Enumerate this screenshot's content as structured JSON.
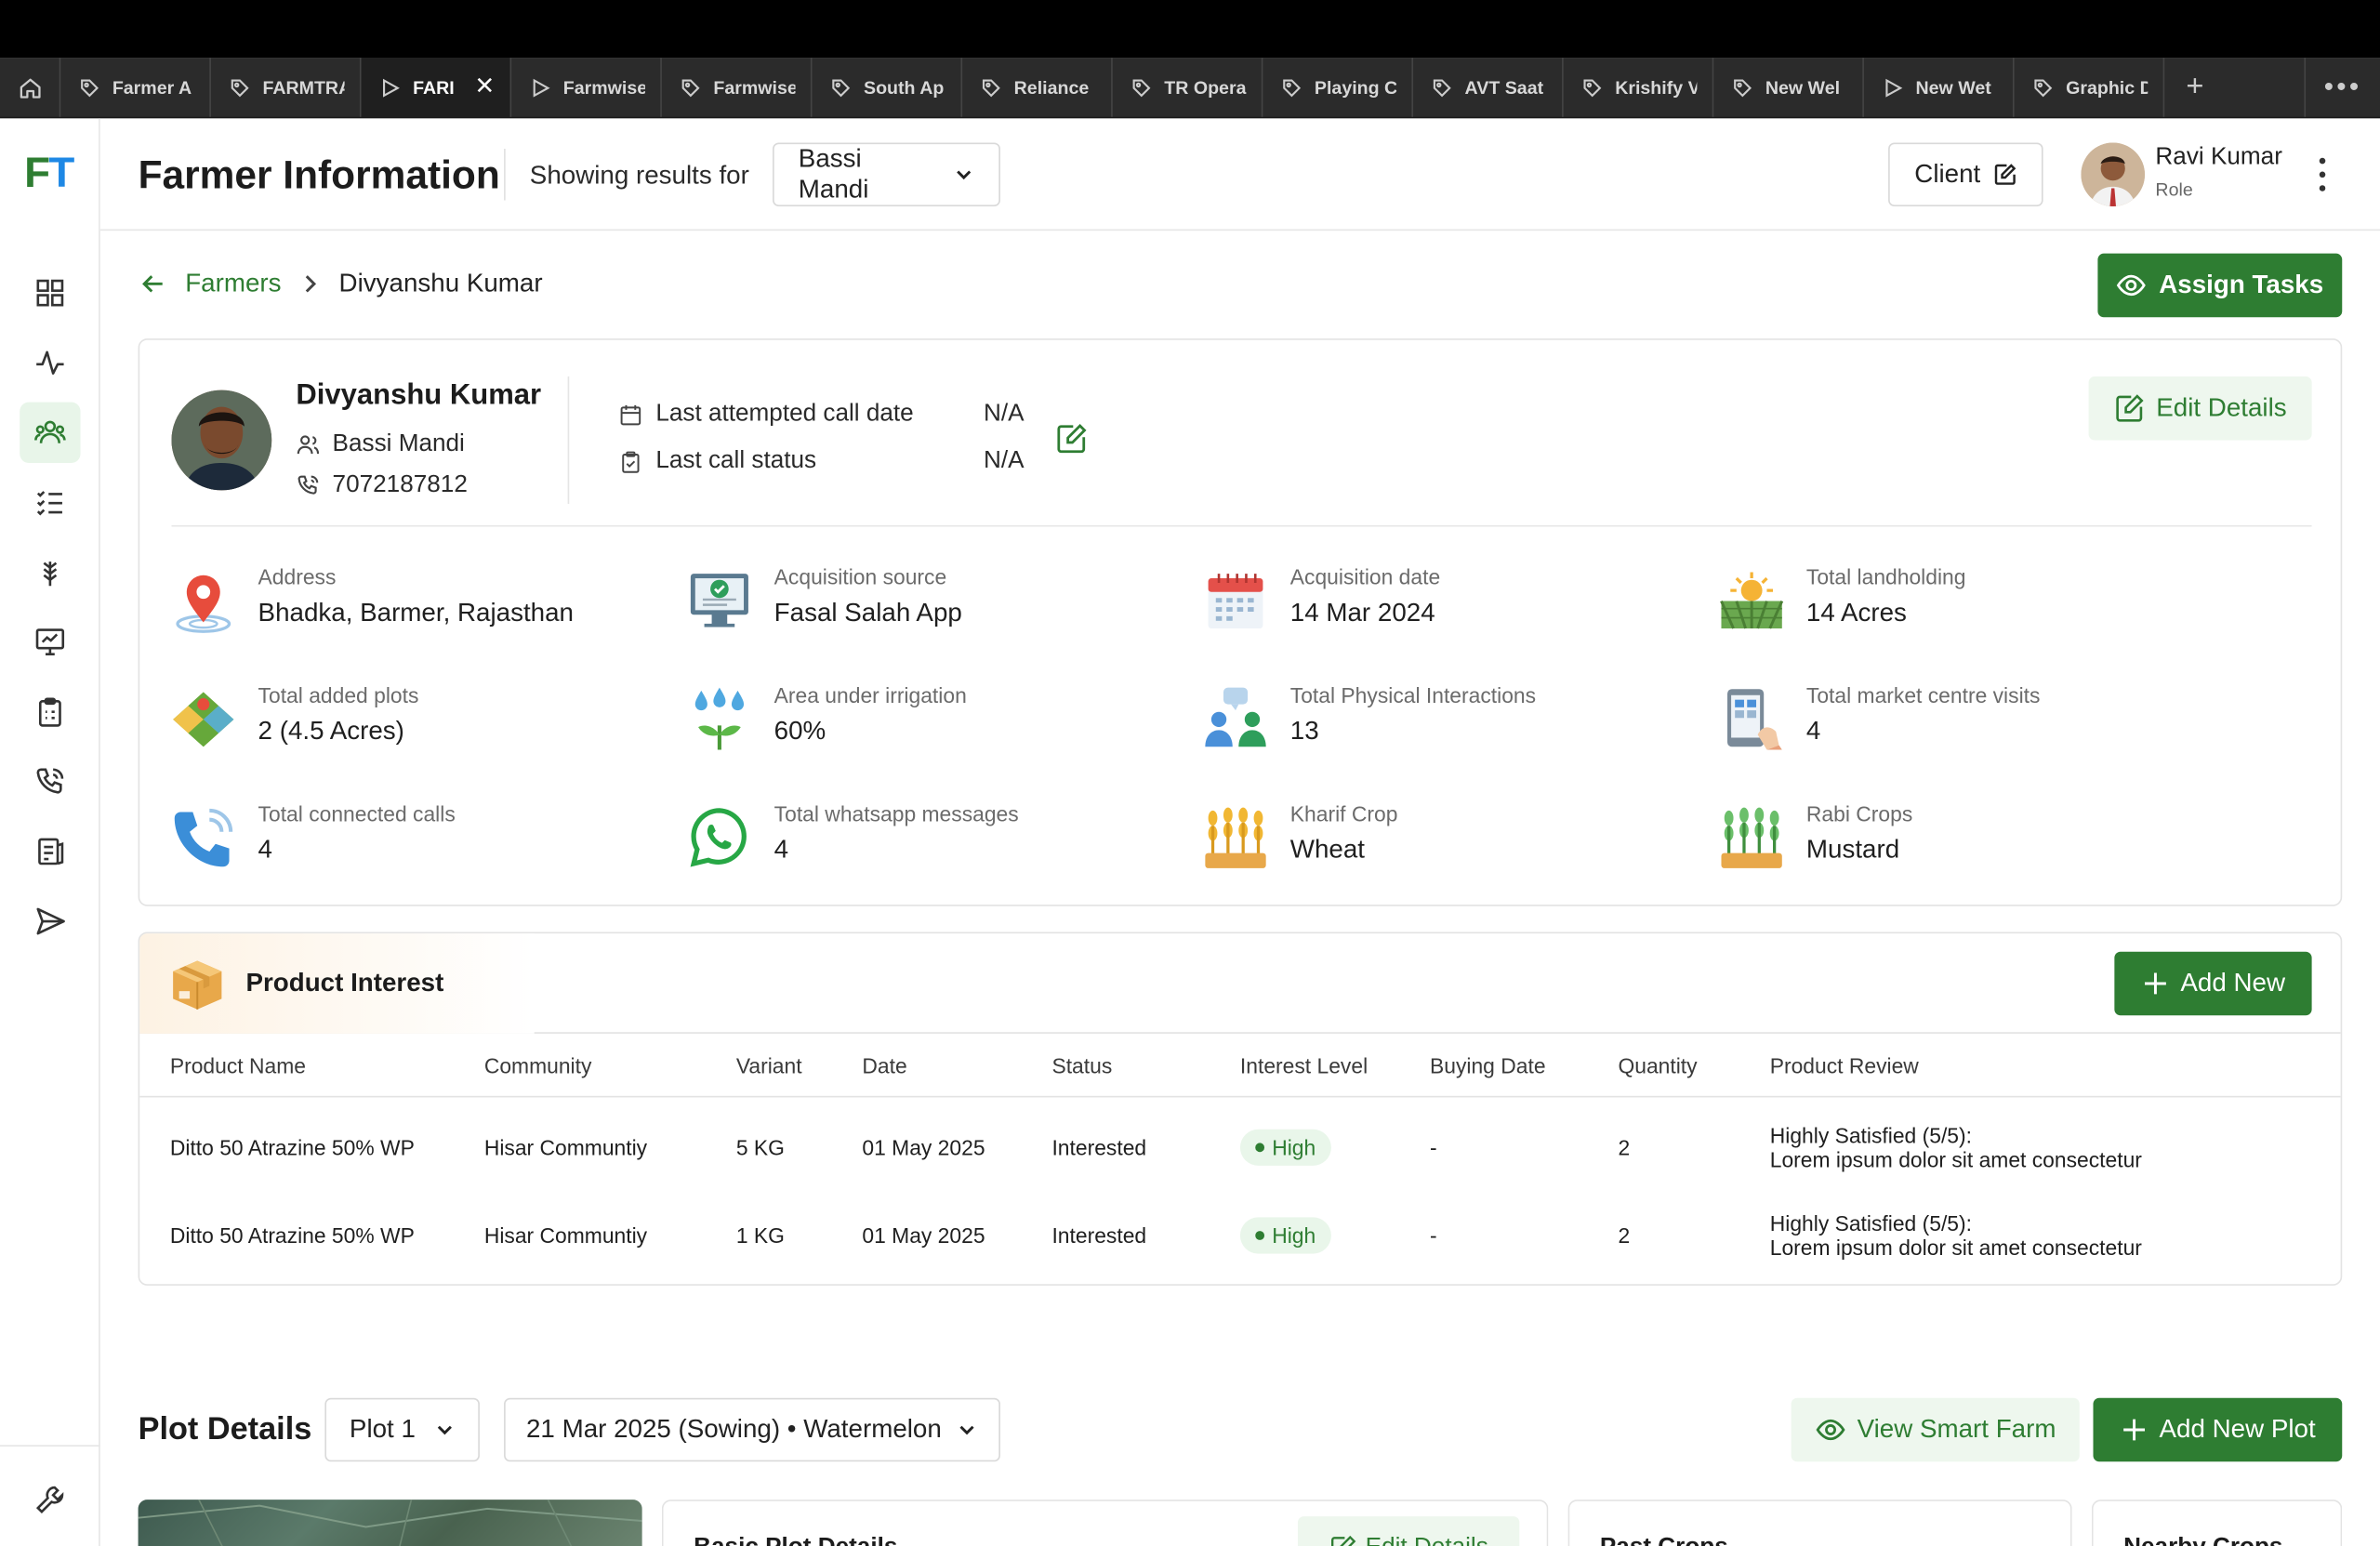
{
  "browser": {
    "tabs": [
      {
        "label": "Farmer A",
        "icon": "tag-icon"
      },
      {
        "label": "FARMTRA",
        "icon": "tag-icon"
      },
      {
        "label": "FARI",
        "icon": "play-icon",
        "active": true
      },
      {
        "label": "Farmwise",
        "icon": "play-icon"
      },
      {
        "label": "Farmwise",
        "icon": "tag-icon"
      },
      {
        "label": "South Ap",
        "icon": "tag-icon"
      },
      {
        "label": "Reliance",
        "icon": "tag-icon"
      },
      {
        "label": "TR Opera",
        "icon": "tag-icon"
      },
      {
        "label": "Playing C",
        "icon": "tag-icon"
      },
      {
        "label": "AVT Saat",
        "icon": "tag-icon"
      },
      {
        "label": "Krishify V",
        "icon": "tag-icon"
      },
      {
        "label": "New Wel",
        "icon": "tag-icon"
      },
      {
        "label": "New Wet",
        "icon": "play-icon"
      },
      {
        "label": "Graphic D",
        "icon": "tag-icon"
      }
    ]
  },
  "sidebar": {
    "logo": {
      "f": "F",
      "t": "T"
    },
    "items": [
      "dashboard-icon",
      "activity-icon",
      "farmers-icon",
      "tasks-list-icon",
      "crop-icon",
      "monitor-icon",
      "clipboard-icon",
      "phone-call-icon",
      "report-icon",
      "send-icon"
    ],
    "bottom": "tools-icon"
  },
  "header": {
    "title": "Farmer Information",
    "showing_label": "Showing results for",
    "location": "Bassi Mandi",
    "client_label": "Client",
    "user_name": "Ravi Kumar",
    "user_role": "Role"
  },
  "breadcrumb": {
    "parent": "Farmers",
    "current": "Divyanshu Kumar"
  },
  "actions": {
    "assign_tasks": "Assign Tasks",
    "edit_details": "Edit Details"
  },
  "farmer": {
    "name": "Divyanshu Kumar",
    "location": "Bassi Mandi",
    "phone": "7072187812",
    "last_call_date_label": "Last attempted call date",
    "last_call_date": "N/A",
    "last_call_status_label": "Last call status",
    "last_call_status": "N/A"
  },
  "stats": [
    {
      "label": "Address",
      "value": "Bhadka, Barmer, Rajasthan",
      "icon": "location-pin-icon"
    },
    {
      "label": "Acquisition source",
      "value": "Fasal Salah App",
      "icon": "monitor-check-icon"
    },
    {
      "label": "Acquisition date",
      "value": "14 Mar 2024",
      "icon": "calendar-icon"
    },
    {
      "label": "Total landholding",
      "value": "14 Acres",
      "icon": "field-sun-icon"
    },
    {
      "label": "Total added plots",
      "value": "2 (4.5 Acres)",
      "icon": "plots-icon"
    },
    {
      "label": "Area under irrigation",
      "value": "60%",
      "icon": "irrigation-icon"
    },
    {
      "label": "Total Physical Interactions",
      "value": "13",
      "icon": "people-chat-icon"
    },
    {
      "label": "Total market centre visits",
      "value": "4",
      "icon": "mobile-shop-icon"
    },
    {
      "label": "Total connected calls",
      "value": "4",
      "icon": "phone-icon"
    },
    {
      "label": "Total whatsapp messages",
      "value": "4",
      "icon": "whatsapp-icon"
    },
    {
      "label": "Kharif Crop",
      "value": "Wheat",
      "icon": "wheat-icon"
    },
    {
      "label": "Rabi Crops",
      "value": "Mustard",
      "icon": "mustard-icon"
    }
  ],
  "product_interest": {
    "title": "Product Interest",
    "add_new": "Add New",
    "columns": [
      "Product Name",
      "Community",
      "Variant",
      "Date",
      "Status",
      "Interest Level",
      "Buying Date",
      "Quantity",
      "Product Review"
    ],
    "rows": [
      {
        "product": "Ditto 50 Atrazine 50% WP",
        "community": "Hisar Communtiy",
        "variant": "5 KG",
        "date": "01 May 2025",
        "status": "Interested",
        "interest": "High",
        "buying_date": "-",
        "quantity": "2",
        "review_title": "Highly Satisfied (5/5):",
        "review_text": "Lorem ipsum dolor sit amet consectetur"
      },
      {
        "product": "Ditto 50 Atrazine 50% WP",
        "community": "Hisar Communtiy",
        "variant": "1 KG",
        "date": "01 May 2025",
        "status": "Interested",
        "interest": "High",
        "buying_date": "-",
        "quantity": "2",
        "review_title": "Highly Satisfied (5/5):",
        "review_text": "Lorem ipsum dolor sit amet consectetur"
      }
    ]
  },
  "plot": {
    "title": "Plot Details",
    "selected_plot": "Plot 1",
    "season": "21 Mar 2025 (Sowing) • Watermelon",
    "view_smart_farm": "View Smart Farm",
    "add_new_plot": "Add New Plot",
    "basic_title": "Basic Plot Details",
    "basic_edit": "Edit Details",
    "past_crops": "Past Crops",
    "nearby_crops": "Nearby Crops"
  },
  "colors": {
    "primary": "#2e7d32",
    "primary_light": "#eef7ee",
    "logo_blue": "#1e88e5"
  }
}
